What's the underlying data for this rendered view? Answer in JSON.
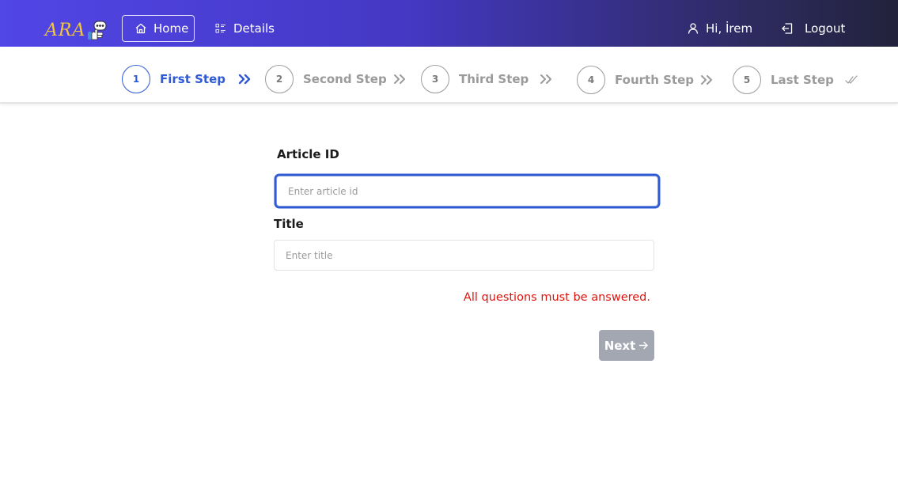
{
  "colors": {
    "navbar_start": "#5146e6",
    "navbar_end": "#22223c",
    "logo": "#f3c63d",
    "active_step": "#2f5ad6",
    "inactive_step": "#9a9a9a",
    "error": "#e0140e",
    "next_button_disabled": "#a3a7b1"
  },
  "navbar": {
    "logo_text": "ARA",
    "logo_icon": "mascot-hand-icon",
    "home_label": "Home",
    "home_icon": "home-icon",
    "details_label": "Details",
    "details_icon": "list-icon",
    "user_greeting": "Hi, İrem",
    "user_icon": "user-icon",
    "logout_label": "Logout",
    "logout_icon": "logout-icon"
  },
  "stepper": {
    "steps": [
      {
        "number": "1",
        "label": "First Step",
        "active": true,
        "icon": "double-chevron-right-icon"
      },
      {
        "number": "2",
        "label": "Second Step",
        "active": false,
        "icon": "double-chevron-right-icon"
      },
      {
        "number": "3",
        "label": "Third Step",
        "active": false,
        "icon": "double-chevron-right-icon"
      },
      {
        "number": "4",
        "label": "Fourth Step",
        "active": false,
        "icon": "double-chevron-right-icon"
      },
      {
        "number": "5",
        "label": "Last Step",
        "active": false,
        "icon": "double-check-icon"
      }
    ]
  },
  "form": {
    "article_id": {
      "label": "Article ID",
      "value": "",
      "placeholder": "Enter article id"
    },
    "title": {
      "label": "Title",
      "value": "",
      "placeholder": "Enter title"
    },
    "error_message": "All questions must be answered.",
    "next_label": "Next",
    "next_icon": "arrow-right-icon"
  }
}
